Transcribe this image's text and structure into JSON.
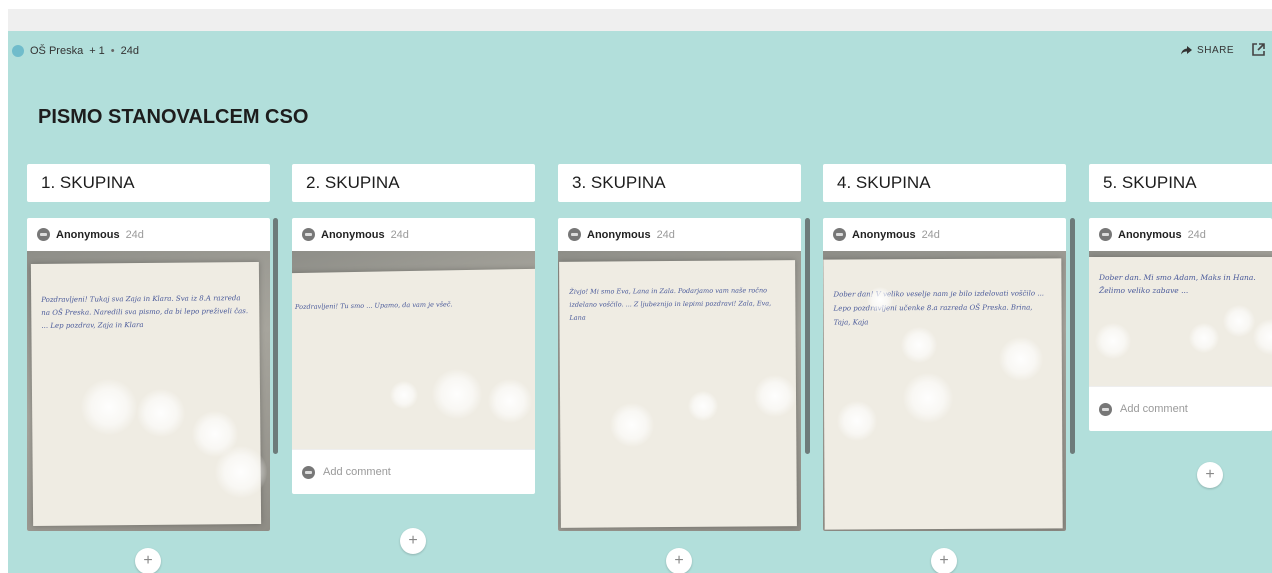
{
  "topbar": {},
  "board": {
    "padlet_name": "OŠ Preska",
    "plus_one": "+ 1",
    "age": "24d",
    "share_label": "SHARE",
    "title": "PISMO STANOVALCEM CSO"
  },
  "columns": [
    {
      "title": "1. SKUPINA",
      "author": "Anonymous",
      "age": "24d",
      "letter": "Pozdravljeni! Tukaj sva Zaja in Klara. Sva iz 8.A razreda na OŠ Preska. Naredili sva pismo, da bi lepo preživeli čas. ... Lep pozdrav, Zaja in Klara",
      "comment": "",
      "add_comment": ""
    },
    {
      "title": "2. SKUPINA",
      "author": "Anonymous",
      "age": "24d",
      "letter": "Pozdravljeni! Tu smo ... Upamo, da vam je všeč.",
      "comment": "",
      "add_comment": "Add comment"
    },
    {
      "title": "3. SKUPINA",
      "author": "Anonymous",
      "age": "24d",
      "letter": "Živjo! Mi smo Eva, Lana in Zala. Podarjamo vam naše ročno izdelano voščilo. ... Z ljubeznijo in lepimi pozdravi! Zala, Eva, Lana",
      "comment": "",
      "add_comment": ""
    },
    {
      "title": "4. SKUPINA",
      "author": "Anonymous",
      "age": "24d",
      "letter": "Dober dan! V veliko veselje nam je bilo izdelovati voščilo ... Lepo pozdravljeni učenke 8.a razreda OŠ Preska. Brina, Taja, Kaja",
      "comment": "",
      "add_comment": ""
    },
    {
      "title": "5. SKUPINA",
      "author": "Anonymous",
      "age": "24d",
      "letter": "Dober dan. Mi smo Adam, Maks in Hana. Želimo veliko zabave ...",
      "comment": "",
      "add_comment": "Add comment"
    }
  ],
  "colors": {
    "board_bg": "#b2dfdb",
    "card_bg": "#ffffff"
  },
  "icons": [
    "padlet-logo-icon",
    "share-icon",
    "open-external-icon",
    "avatar-icon",
    "plus-icon"
  ]
}
